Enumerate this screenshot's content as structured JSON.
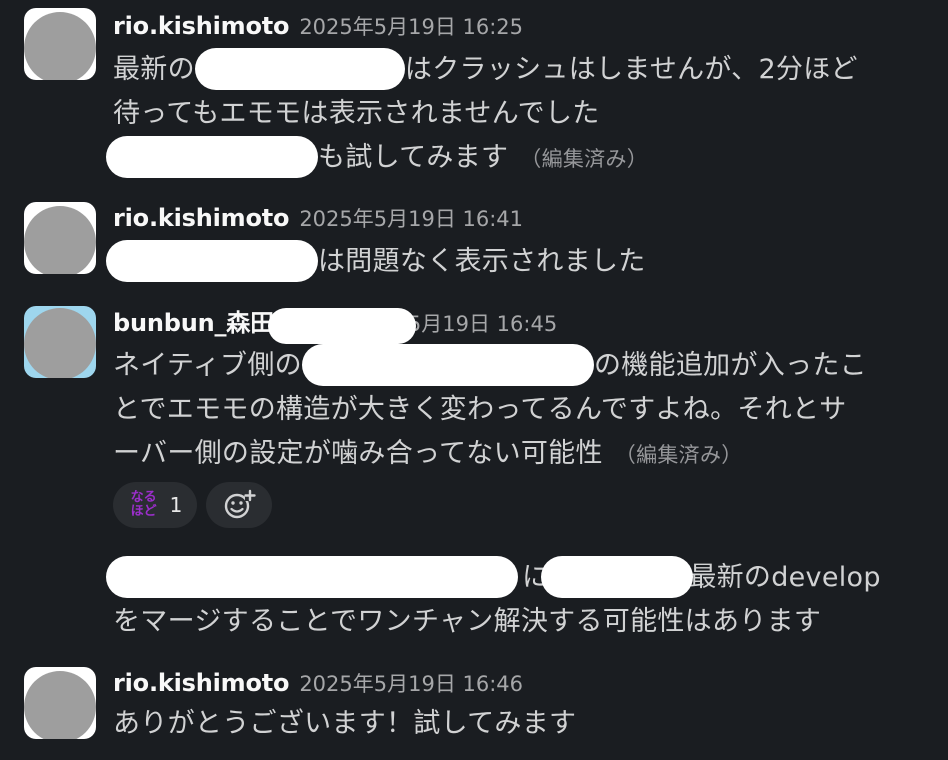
{
  "messages": [
    {
      "username": "rio.kishimoto",
      "timestamp": "2025年5月19日 16:25",
      "lines": [
        {
          "before": "最新の",
          "after": "はクラッシュはしませんが、2分ほど"
        },
        {
          "text": "待ってもエモモは表示されませんでした"
        },
        {
          "after": "も試してみます",
          "edited": "（編集済み）"
        }
      ]
    },
    {
      "username": "rio.kishimoto",
      "timestamp": "2025年5月19日 16:41",
      "lines": [
        {
          "after": "は問題なく表示されました"
        }
      ]
    },
    {
      "username": "bunbun_森田",
      "timestamp": "5月19日 16:45",
      "lines": [
        {
          "before": "ネイティブ側の",
          "after": "の機能追加が入ったこ"
        },
        {
          "text": "とでエモモの構造が大きく変わってるんですよね。それとサ"
        },
        {
          "text": "ーバー側の設定が噛み合ってない可能性",
          "edited": "（編集済み）"
        }
      ],
      "reactions": [
        {
          "emoji_top": "なる",
          "emoji_bottom": "ほど",
          "count": "1"
        }
      ],
      "add_reaction_icon": "add-reaction-icon",
      "continuation": [
        {
          "mid": "に",
          "after": "最新のdevelop"
        },
        {
          "text": "をマージすることでワンチャン解決する可能性はあります"
        }
      ]
    },
    {
      "username": "rio.kishimoto",
      "timestamp": "2025年5月19日 16:46",
      "lines": [
        {
          "text": "ありがとうございます！試してみます"
        }
      ]
    }
  ]
}
